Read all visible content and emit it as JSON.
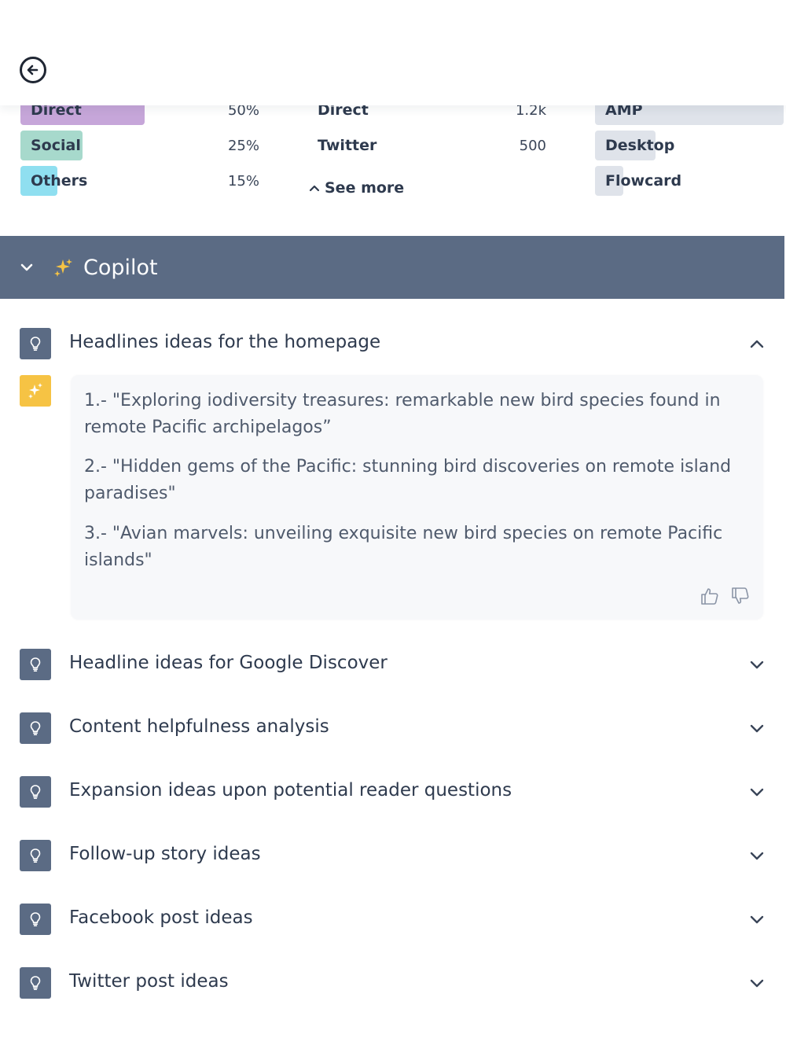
{
  "header": {
    "back_icon": "arrow-left-circle-icon"
  },
  "sources": [
    {
      "label": "Direct",
      "percent": "50%",
      "fraction": 0.5,
      "color": "#c6a6d9"
    },
    {
      "label": "Social",
      "percent": "25%",
      "fraction": 0.25,
      "color": "#a7d9cc"
    },
    {
      "label": "Others",
      "percent": "15%",
      "fraction": 0.15,
      "color": "#8fdff0"
    }
  ],
  "referrers": [
    {
      "label": "Direct",
      "value": "1.2k"
    },
    {
      "label": "Twitter",
      "value": "500"
    }
  ],
  "see_more_label": "See more",
  "platforms": [
    {
      "label": "AMP",
      "fraction": 1.0,
      "color": "#dfe3ea"
    },
    {
      "label": "Desktop",
      "fraction": 0.32,
      "color": "#dfe3ea"
    },
    {
      "label": "Flowcard",
      "fraction": 0.15,
      "color": "#dfe3ea"
    }
  ],
  "copilot": {
    "title": "Copilot",
    "items": [
      {
        "title": "Headlines ideas for the homepage",
        "expanded": true
      },
      {
        "title": "Headline ideas for Google Discover",
        "expanded": false
      },
      {
        "title": "Content helpfulness analysis",
        "expanded": false
      },
      {
        "title": "Expansion ideas upon potential reader questions",
        "expanded": false
      },
      {
        "title": "Follow-up story ideas",
        "expanded": false
      },
      {
        "title": "Facebook post ideas",
        "expanded": false
      },
      {
        "title": "Twitter post ideas",
        "expanded": false
      }
    ],
    "answer": {
      "lines": [
        "1.- \"Exploring iodiversity treasures: remarkable new bird species found in remote Pacific archipelagos”",
        "2.- \"Hidden gems of the Pacific: stunning bird discoveries on remote island paradises\"",
        "3.- \"Avian marvels: unveiling exquisite new bird species on remote Pacific islands\""
      ]
    }
  },
  "colors": {
    "accent_bar": "#5b6b84",
    "ai_icon": "#f6c344"
  }
}
